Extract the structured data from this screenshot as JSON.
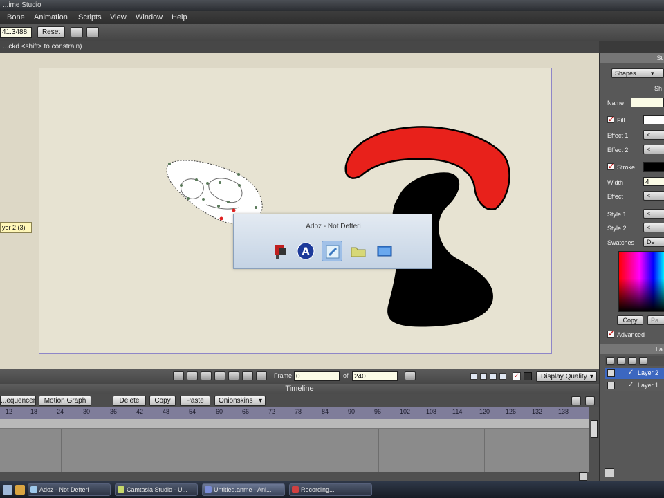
{
  "window": {
    "title": "...ime Studio"
  },
  "menu": [
    "Bone",
    "Animation",
    "Scripts",
    "View",
    "Window",
    "Help"
  ],
  "tool_options": {
    "value": "41.3488",
    "reset_label": "Reset"
  },
  "status_text": "...ckd <shift> to constrain)",
  "layer_hint": "yer 2 (3)",
  "popup": {
    "title": "Adoz - Not Defteri"
  },
  "playback": {
    "frame_label": "Frame",
    "frame_value": "0",
    "of_label": "of",
    "total_value": "240",
    "display_quality": "Display Quality"
  },
  "timeline": {
    "title": "Timeline",
    "tabs": [
      "...equencer",
      "Motion Graph"
    ],
    "actions": [
      "Delete",
      "Copy",
      "Paste"
    ],
    "onionskins": "Onionskins",
    "ticks": [
      "12",
      "18",
      "24",
      "30",
      "36",
      "42",
      "48",
      "54",
      "60",
      "66",
      "72",
      "78",
      "84",
      "90",
      "96",
      "102",
      "108",
      "114",
      "120",
      "126",
      "132",
      "138"
    ]
  },
  "right_panel": {
    "header": "St",
    "shapes_dropdown": "Shapes",
    "section": "Sh",
    "name_label": "Name",
    "fill_label": "Fill",
    "effect1_label": "Effect 1",
    "effect2_label": "Effect 2",
    "stroke_label": "Stroke",
    "width_label": "Width",
    "width_value": "4",
    "effect_label": "Effect",
    "style1_label": "Style 1",
    "style2_label": "Style 2",
    "swatches_label": "Swatches",
    "swatches_value": "De",
    "copy_label": "Copy",
    "paste_label": "Pa",
    "advanced_label": "Advanced",
    "layers_header": "La",
    "layers": [
      "Layer 2",
      "Layer 1"
    ],
    "fill_color": "#ffffff",
    "stroke_color": "#000000"
  },
  "taskbar": [
    {
      "label": "Adoz - Not Defteri",
      "icon_color": "#9ec8ea"
    },
    {
      "label": "Camtasia Studio - U...",
      "icon_color": "#c7d86b"
    },
    {
      "label": "Untitled.anme - Ani...",
      "icon_color": "#7a8cd6"
    },
    {
      "label": "Recording...",
      "icon_color": "#d04040"
    }
  ],
  "colors": {
    "red_shape": "#e8211b",
    "black_shape": "#000000",
    "canvas_bg": "#e7e3d2",
    "stage_border": "#8e86c8"
  },
  "icons": [
    "flag-icon",
    "a-circle-icon",
    "pencil-window-icon",
    "folder-icon",
    "monitor-icon"
  ]
}
